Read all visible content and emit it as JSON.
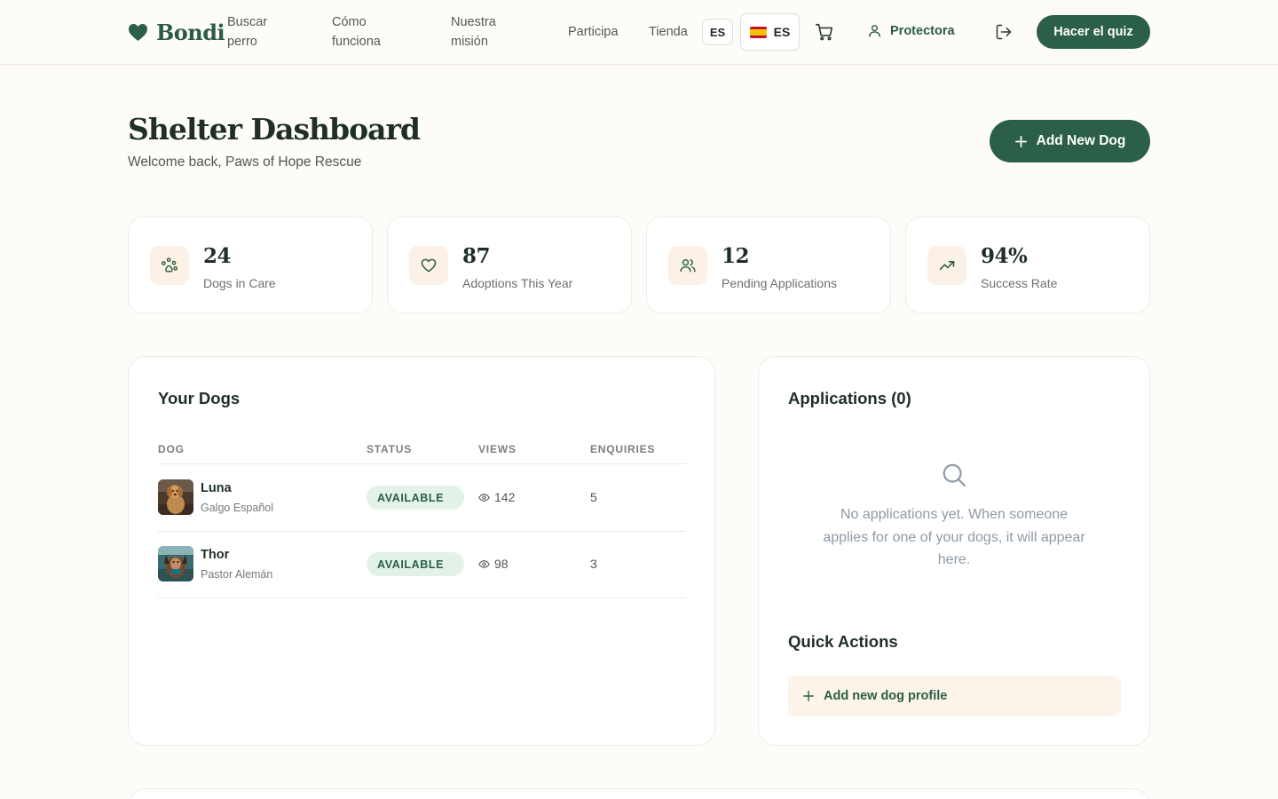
{
  "header": {
    "brand": "Bondi",
    "nav": [
      {
        "label": "Buscar perro"
      },
      {
        "label": "Cómo funciona"
      },
      {
        "label": "Nuestra misión"
      },
      {
        "label": "Participa"
      },
      {
        "label": "Tienda"
      }
    ],
    "lang_code": "ES",
    "lang_selector": "ES",
    "user_label": "Protectora",
    "quiz_button": "Hacer el quiz"
  },
  "page": {
    "title": "Shelter Dashboard",
    "subtitle": "Welcome back, Paws of Hope Rescue",
    "add_button": "Add New Dog"
  },
  "stats": [
    {
      "value": "24",
      "label": "Dogs in Care",
      "icon": "paw-icon"
    },
    {
      "value": "87",
      "label": "Adoptions This Year",
      "icon": "heart-icon"
    },
    {
      "value": "12",
      "label": "Pending Applications",
      "icon": "users-icon"
    },
    {
      "value": "94%",
      "label": "Success Rate",
      "icon": "trending-up-icon"
    }
  ],
  "dogs_panel": {
    "title": "Your Dogs",
    "columns": [
      "DOG",
      "STATUS",
      "VIEWS",
      "ENQUIRIES"
    ],
    "rows": [
      {
        "name": "Luna",
        "breed": "Galgo Español",
        "status": "AVAILABLE",
        "views": "142",
        "enquiries": "5"
      },
      {
        "name": "Thor",
        "breed": "Pastor Alemán",
        "status": "AVAILABLE",
        "views": "98",
        "enquiries": "3"
      }
    ]
  },
  "apps_panel": {
    "title": "Applications (0)",
    "empty_text": "No applications yet. When someone applies for one of your dogs, it will appear here.",
    "quick_actions_title": "Quick Actions",
    "quick_action": "Add new dog profile"
  },
  "colors": {
    "brand": "#2b5f47",
    "background": "#fdfcf8",
    "badge_bg": "#e3f2e6",
    "icon_bg": "#fbf1e6"
  }
}
